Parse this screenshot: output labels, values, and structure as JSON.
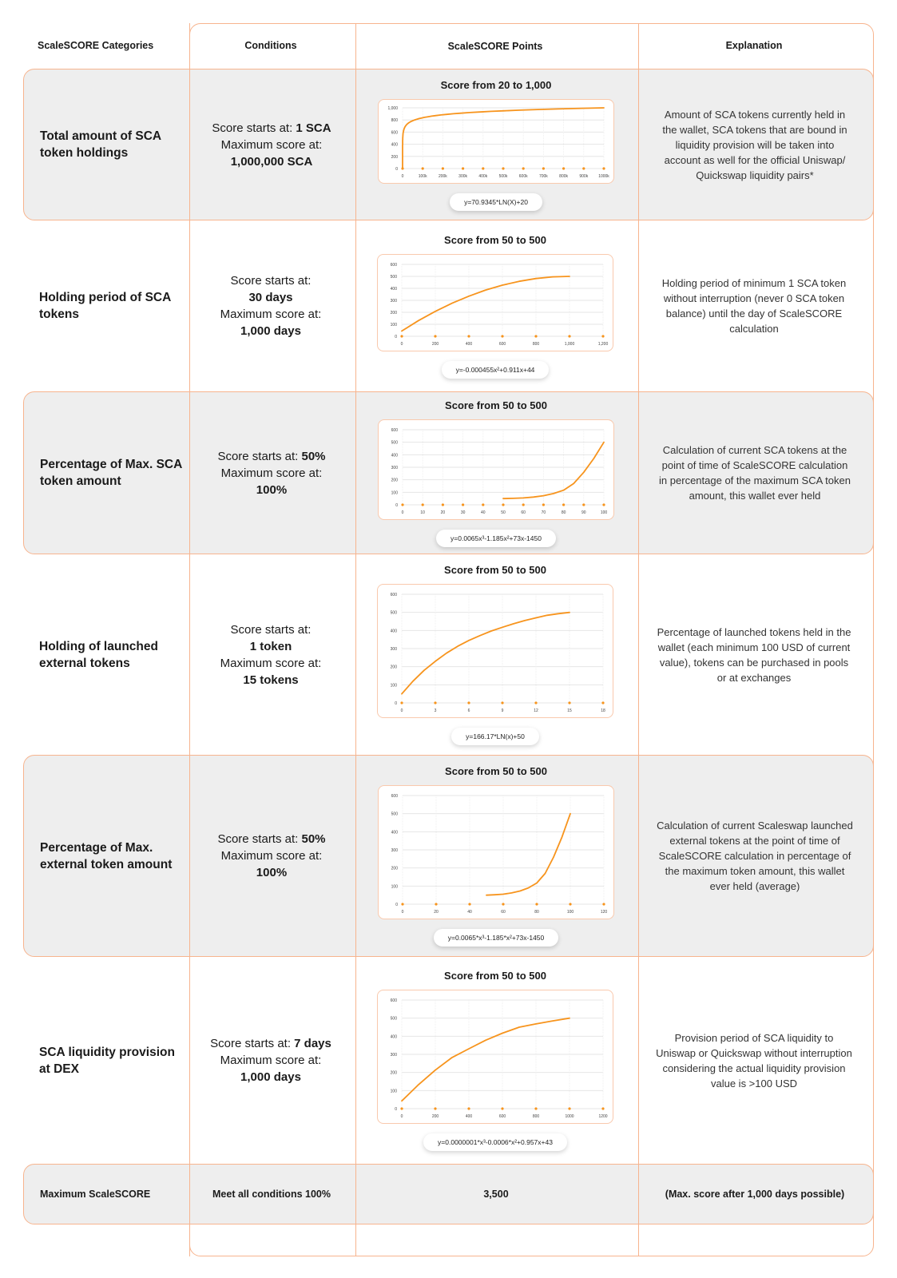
{
  "headers": {
    "categories": "ScaleSCORE Categories",
    "conditions": "Conditions",
    "points": "ScaleSCORE Points",
    "explanation": "Explanation"
  },
  "colors": {
    "accent": "#f7b48e",
    "curve": "#f7941d",
    "shade": "#eeeeee"
  },
  "rows": [
    {
      "category": "Total amount of SCA token holdings",
      "cond": {
        "start_label": "Score starts at:",
        "start_value": "1 SCA",
        "max_label": "Maximum score at:",
        "max_value": "1,000,000 SCA"
      },
      "explanation": "Amount of SCA tokens currently held in the wallet, SCA tokens that are bound in liquidity provision will be taken into account as well for the official Uniswap/ Quickswap liquidity pairs*"
    },
    {
      "category": "Holding period of SCA tokens",
      "cond": {
        "start_label": "Score starts at:",
        "start_value": "30 days",
        "max_label": "Maximum score at:",
        "max_value": "1,000 days"
      },
      "explanation": "Holding period of minimum 1 SCA token without interruption (never 0 SCA token balance) until the day of ScaleSCORE calculation"
    },
    {
      "category": "Percentage of Max. SCA token amount",
      "cond": {
        "start_label": "Score starts at:",
        "start_value": "50%",
        "max_label": "Maximum score at:",
        "max_value": "100%"
      },
      "explanation": "Calculation of current SCA tokens at the point of time of ScaleSCORE calculation in percentage of the maximum SCA token amount, this wallet ever held"
    },
    {
      "category": "Holding of launched external tokens",
      "cond": {
        "start_label": "Score starts at:",
        "start_value": "1 token",
        "max_label": "Maximum score at:",
        "max_value": "15 tokens"
      },
      "explanation": "Percentage of launched tokens held in the wallet (each minimum 100 USD of current value), tokens can be purchased in pools or at exchanges"
    },
    {
      "category": "Percentage of Max. external token amount",
      "cond": {
        "start_label": "Score starts at:",
        "start_value": "50%",
        "max_label": "Maximum score at:",
        "max_value": "100%"
      },
      "explanation": "Calculation of current Scaleswap launched external tokens at the point of time of ScaleSCORE calculation in percentage of the maximum token amount, this wallet ever held (average)"
    },
    {
      "category": "SCA liquidity provision at DEX",
      "cond": {
        "start_label": "Score starts at:",
        "start_value": "7 days",
        "max_label": "Maximum score at:",
        "max_value": "1,000 days"
      },
      "explanation": "Provision period of SCA liquidity to Uniswap or Quickswap without interruption considering the actual liquidity provision value is >100 USD"
    }
  ],
  "total": {
    "category": "Maximum ScaleSCORE",
    "conditions": "Meet all conditions 100%",
    "points": "3,500",
    "explanation": "(Max. score after 1,000 days possible)"
  },
  "chart_data": [
    {
      "type": "line",
      "title": "Score from 20 to 1,000",
      "formula": "y=70.9345*LN(X)+20",
      "xticks": [
        0,
        100000,
        200000,
        300000,
        400000,
        500000,
        600000,
        700000,
        800000,
        900000,
        1000000
      ],
      "xtick_labels": [
        "0",
        "100k",
        "200k",
        "300k",
        "400k",
        "500k",
        "600k",
        "700k",
        "800k",
        "900k",
        "1000k"
      ],
      "yticks": [
        0,
        200,
        400,
        600,
        800,
        1000
      ],
      "ytick_labels": [
        "0",
        "200",
        "400",
        "600",
        "800",
        "1,000"
      ],
      "xlim": [
        0,
        1000000
      ],
      "ylim": [
        0,
        1000
      ],
      "x": [
        1,
        1000,
        10000,
        50000,
        100000,
        200000,
        300000,
        400000,
        500000,
        600000,
        700000,
        800000,
        900000,
        1000000
      ],
      "y": [
        20,
        510,
        673,
        787,
        837,
        886,
        915,
        935,
        951,
        964,
        975,
        984,
        993,
        1000
      ]
    },
    {
      "type": "line",
      "title": "Score from 50 to 500",
      "formula": "y=-0.000455x²+0.911x+44",
      "xticks": [
        0,
        200,
        400,
        600,
        800,
        1000,
        1200
      ],
      "xtick_labels": [
        "0",
        "200",
        "400",
        "600",
        "800",
        "1,000",
        "1,200"
      ],
      "yticks": [
        0,
        100,
        200,
        300,
        400,
        500,
        600
      ],
      "ytick_labels": [
        "0",
        "100",
        "200",
        "300",
        "400",
        "500",
        "600"
      ],
      "xlim": [
        0,
        1200
      ],
      "ylim": [
        0,
        600
      ],
      "x": [
        0,
        100,
        200,
        300,
        400,
        500,
        600,
        700,
        800,
        900,
        1000
      ],
      "y": [
        44,
        131,
        208,
        276,
        335,
        386,
        427,
        459,
        482,
        496,
        500
      ]
    },
    {
      "type": "line",
      "title": "Score from 50 to 500",
      "formula": "y=0.0065x³-1.185x²+73x-1450",
      "xticks": [
        0,
        10,
        20,
        30,
        40,
        50,
        60,
        70,
        80,
        90,
        100
      ],
      "xtick_labels": [
        "0",
        "10",
        "20",
        "30",
        "40",
        "50",
        "60",
        "70",
        "80",
        "90",
        "100"
      ],
      "yticks": [
        0,
        100,
        200,
        300,
        400,
        500,
        600
      ],
      "ytick_labels": [
        "0",
        "100",
        "200",
        "300",
        "400",
        "500",
        "600"
      ],
      "xlim": [
        0,
        100
      ],
      "ylim": [
        0,
        600
      ],
      "x": [
        50,
        55,
        60,
        65,
        70,
        75,
        80,
        85,
        90,
        95,
        100
      ],
      "y": [
        50,
        52,
        55,
        62,
        73,
        90,
        117,
        170,
        260,
        370,
        500
      ]
    },
    {
      "type": "line",
      "title": "Score from 50 to 500",
      "formula": "y=166.17*LN(x)+50",
      "xticks": [
        0,
        3,
        6,
        9,
        12,
        15,
        18
      ],
      "xtick_labels": [
        "0",
        "3",
        "6",
        "9",
        "12",
        "15",
        "18"
      ],
      "yticks": [
        0,
        100,
        200,
        300,
        400,
        500,
        600
      ],
      "ytick_labels": [
        "0",
        "100",
        "200",
        "300",
        "400",
        "500",
        "600"
      ],
      "xlim": [
        0,
        18
      ],
      "ylim": [
        0,
        600
      ],
      "x": [
        0,
        1,
        2,
        3,
        4,
        5,
        6,
        7,
        8,
        9,
        10,
        11,
        12,
        13,
        14,
        15
      ],
      "y": [
        50,
        120,
        180,
        230,
        275,
        313,
        345,
        372,
        397,
        418,
        437,
        455,
        470,
        484,
        493,
        500
      ]
    },
    {
      "type": "line",
      "title": "Score from 50 to 500",
      "formula": "y=0.0065*x³-1.185*x²+73x-1450",
      "xticks": [
        0,
        20,
        40,
        60,
        80,
        100,
        120
      ],
      "xtick_labels": [
        "0",
        "20",
        "40",
        "60",
        "80",
        "100",
        "120"
      ],
      "yticks": [
        0,
        100,
        200,
        300,
        400,
        500,
        600
      ],
      "ytick_labels": [
        "0",
        "100",
        "200",
        "300",
        "400",
        "500",
        "600"
      ],
      "xlim": [
        0,
        120
      ],
      "ylim": [
        0,
        600
      ],
      "x": [
        50,
        55,
        60,
        65,
        70,
        75,
        80,
        85,
        90,
        95,
        100
      ],
      "y": [
        50,
        52,
        55,
        62,
        73,
        90,
        117,
        170,
        260,
        370,
        500
      ]
    },
    {
      "type": "line",
      "title": "Score from 50 to 500",
      "formula": "y=0.0000001*x³-0.0006*x²+0.957x+43",
      "xticks": [
        0,
        200,
        400,
        600,
        800,
        1000,
        1200
      ],
      "xtick_labels": [
        "0",
        "200",
        "400",
        "600",
        "800",
        "1000",
        "1200"
      ],
      "yticks": [
        0,
        100,
        200,
        300,
        400,
        500,
        600
      ],
      "ytick_labels": [
        "0",
        "100",
        "200",
        "300",
        "400",
        "500",
        "600"
      ],
      "xlim": [
        0,
        1200
      ],
      "ylim": [
        0,
        600
      ],
      "x": [
        0,
        100,
        200,
        300,
        400,
        500,
        600,
        700,
        800,
        900,
        1000
      ],
      "y": [
        43,
        133,
        213,
        283,
        331,
        378,
        417,
        450,
        468,
        485,
        500
      ]
    }
  ]
}
